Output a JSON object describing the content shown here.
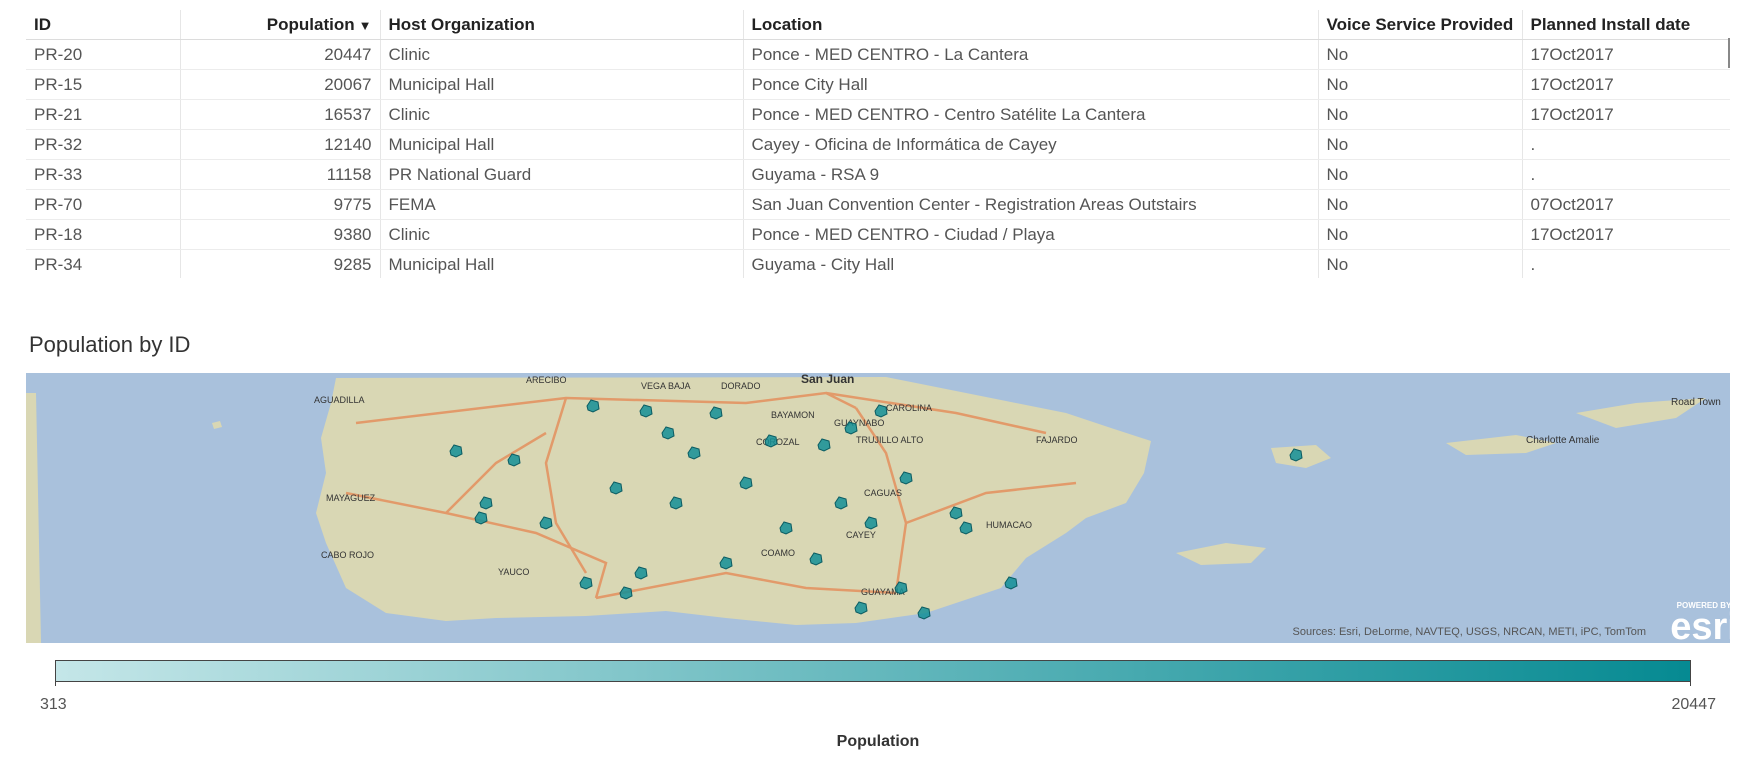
{
  "table": {
    "columns": [
      {
        "label": "ID",
        "align": "left"
      },
      {
        "label": "Population",
        "align": "right",
        "sort": "▼"
      },
      {
        "label": "Host Organization",
        "align": "left"
      },
      {
        "label": "Location",
        "align": "left"
      },
      {
        "label": "Voice Service Provided",
        "align": "left"
      },
      {
        "label": "Planned Install date",
        "align": "left"
      }
    ],
    "rows": [
      [
        "PR-20",
        "20447",
        "Clinic",
        "Ponce - MED CENTRO - La Cantera",
        "No",
        "17Oct2017"
      ],
      [
        "PR-15",
        "20067",
        "Municipal Hall",
        "Ponce City Hall",
        "No",
        "17Oct2017"
      ],
      [
        "PR-21",
        "16537",
        "Clinic",
        "Ponce - MED CENTRO - Centro Satélite La Cantera",
        "No",
        "17Oct2017"
      ],
      [
        "PR-32",
        "12140",
        "Municipal Hall",
        "Cayey - Oficina de Informática de Cayey",
        "No",
        "."
      ],
      [
        "PR-33",
        "11158",
        "PR National Guard",
        "Guyama - RSA 9",
        "No",
        "."
      ],
      [
        "PR-70",
        "9775",
        "FEMA",
        "San Juan Convention Center - Registration Areas Outstairs",
        "No",
        "07Oct2017"
      ],
      [
        "PR-18",
        "9380",
        "Clinic",
        "Ponce - MED CENTRO - Ciudad / Playa",
        "No",
        "17Oct2017"
      ],
      [
        "PR-34",
        "9285",
        "Municipal Hall",
        "Guyama - City Hall",
        "No",
        "."
      ]
    ]
  },
  "map": {
    "title": "Population by ID",
    "attribution": "Sources: Esri, DeLorme, NAVTEQ, USGS, NRCAN, METI, iPC, TomTom",
    "logo_small": "POWERED BY",
    "logo_big": "esri",
    "place_labels": [
      "San Juan",
      "AGUADILLA",
      "ARECIBO",
      "VEGA BAJA",
      "DORADO",
      "BAYAMON",
      "CAROLINA",
      "GUAYNABO",
      "TRUJILLO ALTO",
      "FAJARDO",
      "MAYAGUEZ",
      "CAGUAS",
      "HUMACAO",
      "CABO ROJO",
      "YAUCO",
      "COAMO",
      "CAYEY",
      "GUAYAMA",
      "COROZAL",
      "Charlotte Amalie",
      "Road Town"
    ],
    "colors": {
      "water": "#a9c1dc",
      "land": "#d9d7b4",
      "marker": "#138f97"
    }
  },
  "legend": {
    "min": "313",
    "max": "20447",
    "title": "Population",
    "color_low": "#c4e6e8",
    "color_high": "#068a92"
  }
}
